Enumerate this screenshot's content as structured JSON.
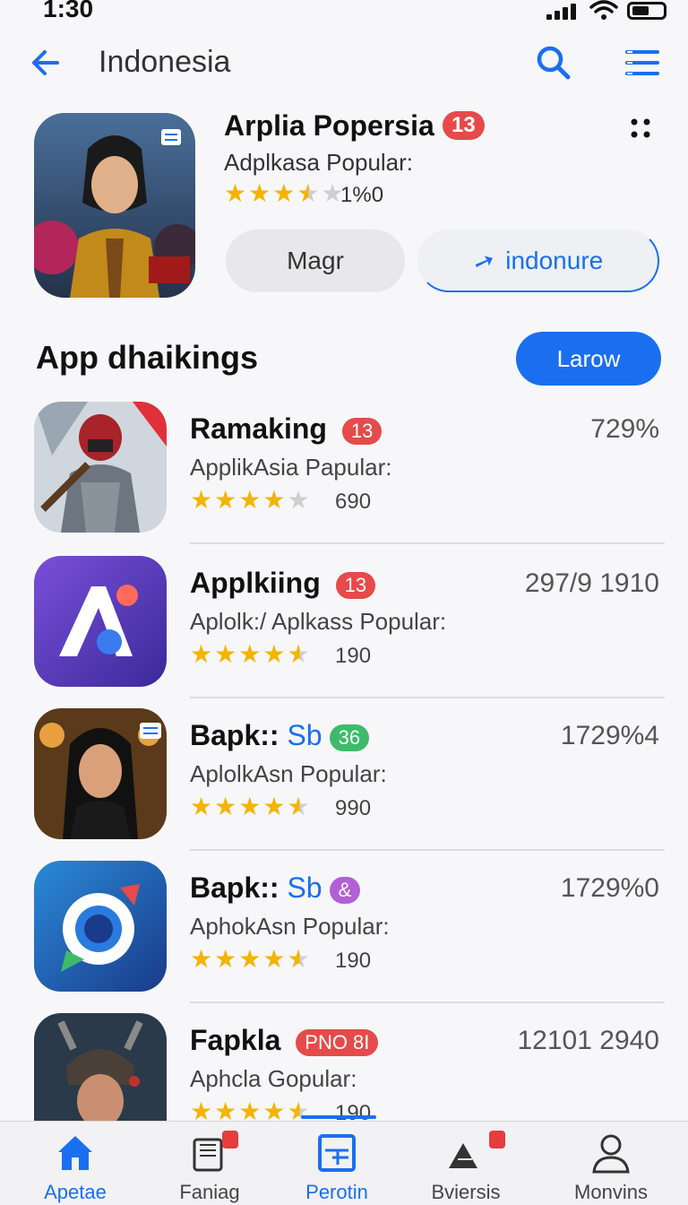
{
  "status": {
    "time": "1:30"
  },
  "header": {
    "title": "Indonesia"
  },
  "featured": {
    "title": "Arplia Popersia",
    "badge": "13",
    "subtitle": "Adplkasa Popular:",
    "rating": 3.5,
    "count": "1%0",
    "manage_label": "Magr",
    "install_label": "indonure"
  },
  "section": {
    "title": "App dhaikings",
    "button_label": "Larow"
  },
  "apps": [
    {
      "name": "Ramaking",
      "accent": "",
      "badge": "13",
      "badge_color": "#e64a4a",
      "subtitle": "ApplikAsia Papular:",
      "rating": 4,
      "count": "690",
      "metric": "729%"
    },
    {
      "name": "Applkiing",
      "accent": "",
      "badge": "13",
      "badge_color": "#e64a4a",
      "subtitle": "Aplolk:/ Aplkass Popular:",
      "rating": 4.5,
      "count": "190",
      "metric": "297/9 1910"
    },
    {
      "name": "Bapk::",
      "accent": "Sb",
      "badge": "36",
      "badge_color": "#3dbb6a",
      "subtitle": "AplolkAsn Popular:",
      "rating": 4.5,
      "count": "990",
      "metric": "1729%4"
    },
    {
      "name": "Bapk::",
      "accent": "Sb",
      "badge": "&",
      "badge_color": "#b35fd6",
      "subtitle": "AphokAsn Popular:",
      "rating": 4.5,
      "count": "190",
      "metric": "1729%0"
    },
    {
      "name": "Fapkla",
      "accent": "",
      "badge": "PNO 8I",
      "badge_color": "#e64a4a",
      "subtitle": "Aphcla Gopular:",
      "rating": 4.5,
      "count": "190",
      "metric": "12101 2940"
    }
  ],
  "tabs": [
    {
      "label": "Apetae",
      "icon": "home-icon",
      "active": true
    },
    {
      "label": "Faniag",
      "icon": "library-icon",
      "active": false
    },
    {
      "label": "Perotin",
      "icon": "update-icon",
      "active": true
    },
    {
      "label": "Bviersis",
      "icon": "games-icon",
      "active": false
    },
    {
      "label": "Monvins",
      "icon": "profile-icon",
      "active": false
    }
  ],
  "colors": {
    "accent": "#1a6ff0",
    "star": "#f4b400",
    "badge_red": "#e64a4a"
  }
}
